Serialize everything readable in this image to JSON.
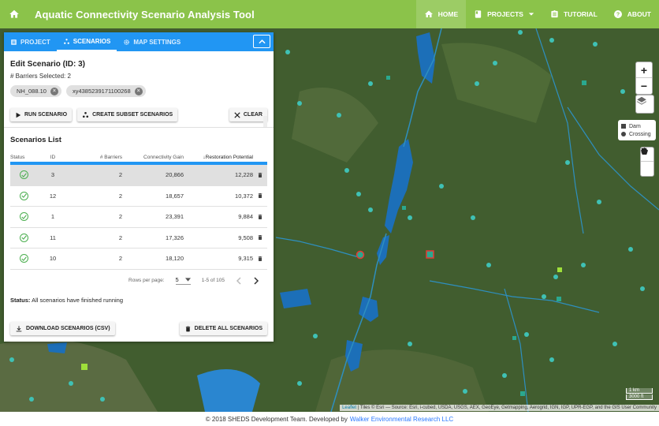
{
  "app": {
    "title": "Aquatic Connectivity Scenario Analysis Tool",
    "nav": [
      {
        "label": "HOME",
        "icon": "home-icon"
      },
      {
        "label": "PROJECTS",
        "icon": "book-icon"
      },
      {
        "label": "TUTORIAL",
        "icon": "clipboard-icon"
      },
      {
        "label": "ABOUT",
        "icon": "help-icon"
      }
    ],
    "accent": "#8bc34a",
    "primary": "#2196f3"
  },
  "panel": {
    "tabs": [
      {
        "label": "PROJECT",
        "icon": "project-icon"
      },
      {
        "label": "SCENARIOS",
        "icon": "scenarios-icon"
      },
      {
        "label": "MAP SETTINGS",
        "icon": "gear-icon"
      }
    ],
    "edit_title": "Edit Scenario (ID: 3)",
    "barriers_selected": "# Barriers Selected: 2",
    "chips": [
      "NH_088.10",
      "xy4385239171100268"
    ],
    "buttons": {
      "run": "RUN SCENARIO",
      "subset": "CREATE SUBSET SCENARIOS",
      "clear": "CLEAR",
      "download": "DOWNLOAD SCENARIOS (CSV)",
      "delete_all": "DELETE ALL SCENARIOS"
    },
    "list_title": "Scenarios List",
    "columns": [
      "Status",
      "ID",
      "# Barriers",
      "Connectivity Gain",
      "Restoration Potential"
    ],
    "rows": [
      {
        "id": "3",
        "barriers": "2",
        "gain": "20,866",
        "potential": "12,228",
        "selected": true
      },
      {
        "id": "12",
        "barriers": "2",
        "gain": "18,657",
        "potential": "10,372",
        "selected": false
      },
      {
        "id": "1",
        "barriers": "2",
        "gain": "23,391",
        "potential": "9,884",
        "selected": false
      },
      {
        "id": "11",
        "barriers": "2",
        "gain": "17,326",
        "potential": "9,508",
        "selected": false
      },
      {
        "id": "10",
        "barriers": "2",
        "gain": "18,120",
        "potential": "9,315",
        "selected": false
      }
    ],
    "pager": {
      "rows_per_page_label": "Rows per page:",
      "rows_per_page": "5",
      "range": "1-5 of 105"
    },
    "status_label": "Status:",
    "status_text": " All scenarios have finished running"
  },
  "map": {
    "legend": [
      "Dam",
      "Crossing"
    ],
    "scale": [
      "1 km",
      "3000 ft"
    ],
    "attribution_link": "Leaflet",
    "attribution_text": " | Tiles © Esri — Source: Esri, i-cubed, USDA, USGS, AEX, GeoEye, Getmapping, Aerogrid, IGN, IGP, UPR-EGP, and the GIS User Community"
  },
  "footer": {
    "text": "© 2018 SHEDS Development Team. Developed by",
    "link": "Walker Environmental Research LLC"
  }
}
